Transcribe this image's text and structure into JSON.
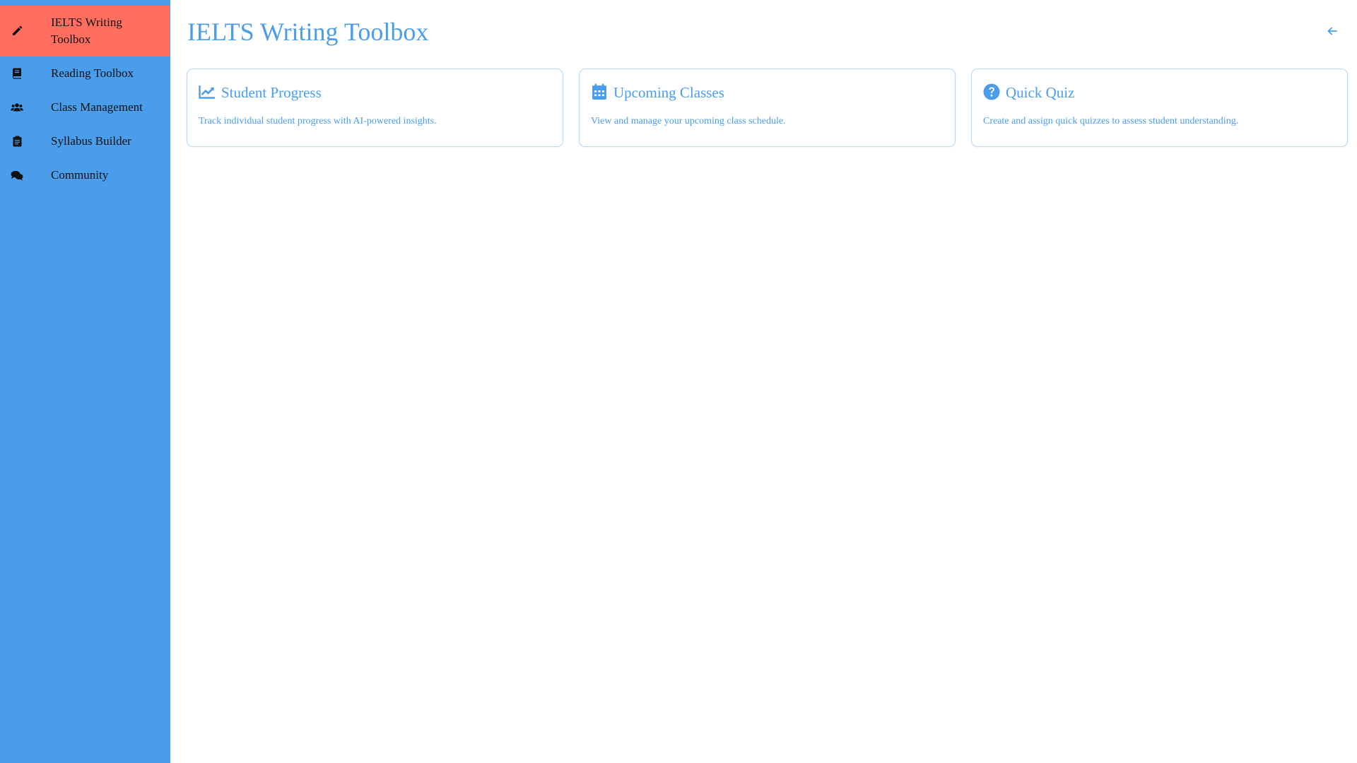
{
  "sidebar": {
    "items": [
      {
        "label": "IELTS Writing Toolbox",
        "icon": "pencil-icon",
        "active": true
      },
      {
        "label": "Reading Toolbox",
        "icon": "book-icon",
        "active": false
      },
      {
        "label": "Class Management",
        "icon": "users-icon",
        "active": false
      },
      {
        "label": "Syllabus Builder",
        "icon": "clipboard-icon",
        "active": false
      },
      {
        "label": "Community",
        "icon": "comments-icon",
        "active": false
      }
    ]
  },
  "header": {
    "title": "IELTS Writing Toolbox",
    "back_icon": "arrow-left-icon"
  },
  "cards": [
    {
      "title": "Student Progress",
      "description": "Track individual student progress with AI-powered insights.",
      "icon": "chart-line-icon"
    },
    {
      "title": "Upcoming Classes",
      "description": "View and manage your upcoming class schedule.",
      "icon": "calendar-icon"
    },
    {
      "title": "Quick Quiz",
      "description": "Create and assign quick quizzes to assess student understanding.",
      "icon": "question-circle-icon"
    }
  ],
  "colors": {
    "sidebar_bg": "#4a9dea",
    "active_item_bg": "#ff6e5f",
    "accent": "#4a9dea",
    "card_border": "#b9d8f5"
  }
}
